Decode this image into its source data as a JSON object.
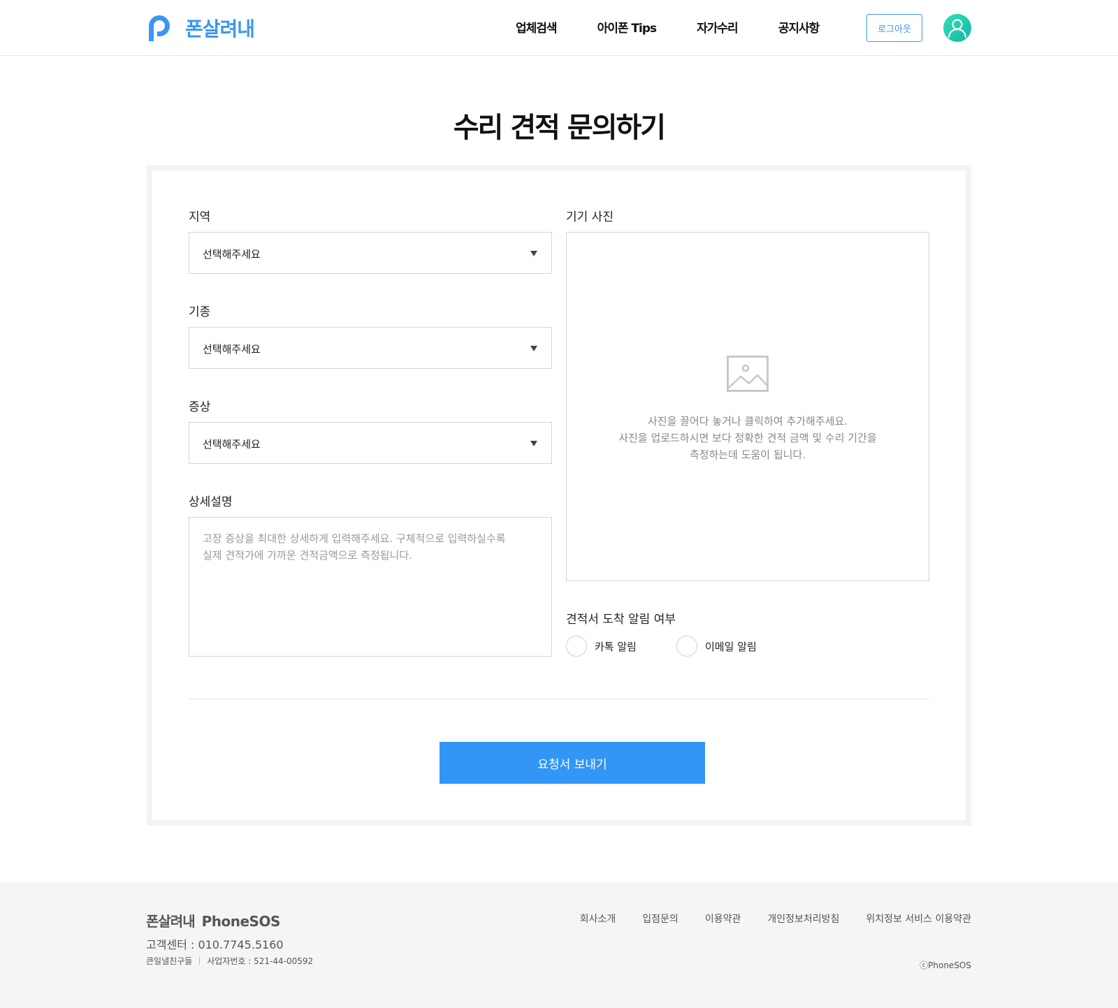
{
  "header": {
    "brand_name": "폰살려내",
    "nav": [
      "업체검색",
      "아이폰 Tips",
      "자가수리",
      "공지사항"
    ],
    "logout_label": "로그아웃",
    "accent_color": "#3a96f5"
  },
  "page": {
    "title": "수리 견적 문의하기"
  },
  "form": {
    "region": {
      "label": "지역",
      "value": "선택해주세요"
    },
    "model": {
      "label": "기종",
      "value": "선택해주세요"
    },
    "symptom": {
      "label": "증상",
      "value": "선택해주세요"
    },
    "detail": {
      "label": "상세설명",
      "placeholder": "고장 증상을 최대한 상세하게 입력해주세요. 구체적으로 입력하실수록\n실제 견적가에 가까운 견적금액으로 측정됩니다."
    },
    "photo": {
      "label": "기기 사진",
      "hint_lines": [
        "사진을 끌어다 놓거나 클릭하여 추가해주세요.",
        "사진을 업로드하시면 보다 정확한 견적 금액 및 수리 기간을",
        "측정하는데 도움이 됩니다."
      ],
      "icon": "image-placeholder-icon"
    },
    "notify": {
      "label": "견적서 도착 알림 여부",
      "options": [
        "카톡 알림",
        "이메일 알림"
      ]
    },
    "submit_label": "요청서 보내기",
    "submit_color": "#3196f6"
  },
  "footer": {
    "brand_kr": "폰살려내",
    "brand_en": "PhoneSOS",
    "customer_center": "고객센터 : 010.7745.5160",
    "company": "큰일낼친구들",
    "biz_no": "사업자번호 : 521-44-00592",
    "links": [
      "회사소개",
      "입점문의",
      "이용약관",
      "개인정보처리방침",
      "위치정보 서비스 이용약관"
    ],
    "copyright": "ⓒPhoneSOS"
  }
}
